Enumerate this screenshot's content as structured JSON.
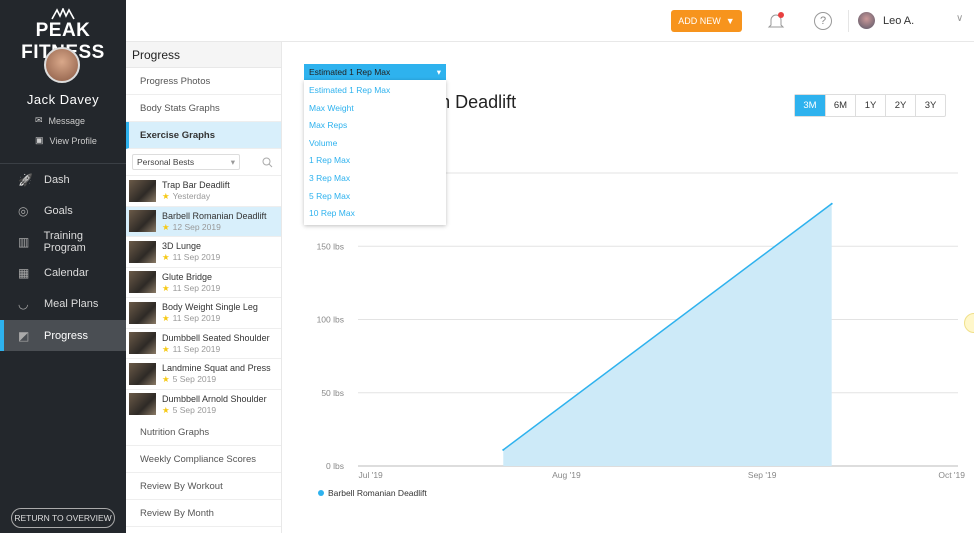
{
  "brand": "PEAK FITNESS",
  "profile": {
    "name": "Jack Davey",
    "message": "Message",
    "view_profile": "View Profile"
  },
  "nav": [
    {
      "label": "Dash",
      "icon": "rocket-icon"
    },
    {
      "label": "Goals",
      "icon": "target-icon"
    },
    {
      "label": "Training Program",
      "icon": "map-icon"
    },
    {
      "label": "Calendar",
      "icon": "calendar-icon"
    },
    {
      "label": "Meal Plans",
      "icon": "bowl-icon"
    },
    {
      "label": "Progress",
      "icon": "chart-icon",
      "active": true
    }
  ],
  "return_label": "RETURN TO OVERVIEW",
  "topbar": {
    "add_new": "ADD NEW",
    "help": "?",
    "user": "Leo A."
  },
  "sub": {
    "title": "Progress",
    "items_top": [
      "Progress Photos",
      "Body Stats Graphs",
      "Exercise Graphs"
    ],
    "filter": "Personal Bests",
    "exercises": [
      {
        "name": "Trap Bar Deadlift",
        "date": "Yesterday"
      },
      {
        "name": "Barbell Romanian Deadlift",
        "date": "12 Sep 2019",
        "active": true
      },
      {
        "name": "3D Lunge",
        "date": "11 Sep 2019"
      },
      {
        "name": "Glute Bridge",
        "date": "11 Sep 2019"
      },
      {
        "name": "Body Weight Single Leg",
        "date": "11 Sep 2019"
      },
      {
        "name": "Dumbbell Seated Shoulder",
        "date": "11 Sep 2019"
      },
      {
        "name": "Landmine Squat and Press",
        "date": "5 Sep 2019"
      },
      {
        "name": "Dumbbell Arnold Shoulder",
        "date": "5 Sep 2019"
      }
    ],
    "items_bottom": [
      "Nutrition Graphs",
      "Weekly Compliance Scores",
      "Review By Workout",
      "Review By Month"
    ]
  },
  "metric_dropdown": {
    "selected": "Estimated 1 Rep Max",
    "options": [
      "Estimated 1 Rep Max",
      "Max Weight",
      "Max Reps",
      "Volume",
      "1 Rep Max",
      "3 Rep Max",
      "5 Rep Max",
      "10 Rep Max"
    ]
  },
  "ranges": [
    "3M",
    "6M",
    "1Y",
    "2Y",
    "3Y"
  ],
  "active_range": "3M",
  "colors": {
    "accent": "#2eb2ee",
    "sidebar": "#23272c",
    "add_new": "#f7941d"
  },
  "chart_data": {
    "type": "area",
    "title": "Barbell Romanian Deadlift",
    "series": [
      {
        "name": "Barbell Romanian Deadlift",
        "x": [
          "2019-07-22",
          "2019-09-12"
        ],
        "y": [
          11,
          179
        ]
      }
    ],
    "xlim": [
      "2019-06-29",
      "2019-10-02"
    ],
    "xticks": [
      {
        "date": "2019-07-01",
        "label": "Jul '19"
      },
      {
        "date": "2019-08-01",
        "label": "Aug '19"
      },
      {
        "date": "2019-09-01",
        "label": "Sep '19"
      },
      {
        "date": "2019-10-01",
        "label": "Oct '19"
      }
    ],
    "ylim": [
      0,
      200
    ],
    "yticks": [
      {
        "v": 0,
        "label": "0 lbs"
      },
      {
        "v": 50,
        "label": "50 lbs"
      },
      {
        "v": 100,
        "label": "100 lbs"
      },
      {
        "v": 150,
        "label": "150 lbs"
      },
      {
        "v": 200,
        "label": ""
      }
    ],
    "grid": true,
    "legend": "bottom-left"
  }
}
